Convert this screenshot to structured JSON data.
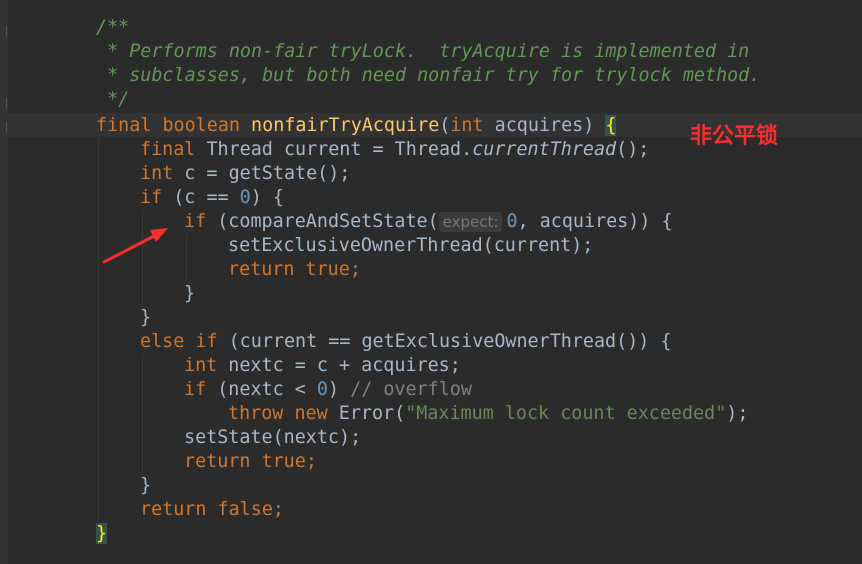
{
  "editor": {
    "annotation": "非公平锁",
    "colors": {
      "background": "#2b2b2b",
      "keyword": "#cc7832",
      "function": "#ffc66d",
      "doc_comment": "#629755",
      "number": "#6897bb",
      "string": "#6a8759",
      "annotation": "#ff2d2d"
    },
    "lines": {
      "l1": {
        "doc": "/**"
      },
      "l2": {
        "doc": " * Performs non-fair tryLock.  tryAcquire is implemented in"
      },
      "l3": {
        "doc": " * subclasses, but both need nonfair try for trylock method."
      },
      "l4": {
        "doc": " */"
      },
      "l5": {
        "kw1": "final",
        "kw2": "boolean",
        "fn": "nonfairTryAcquire",
        "p1": "(",
        "kw3": "int",
        "p2": " acquires) ",
        "brace": "{"
      },
      "l6": {
        "kw": "final",
        "t1": " Thread current = Thread.",
        "it": "currentThread",
        "t2": "();"
      },
      "l7": {
        "kw": "int",
        "t1": " c = getState();"
      },
      "l8": {
        "kw": "if",
        "t1": " (c == ",
        "num": "0",
        "t2": ") {"
      },
      "l9": {
        "kw": "if",
        "t1": " (compareAndSetState(",
        "hint": "expect:",
        "num": "0",
        "t2": ", acquires)) {"
      },
      "l10": {
        "t1": "setExclusiveOwnerThread(current);"
      },
      "l11": {
        "kw1": "return",
        "kw2": "true",
        "t1": ";"
      },
      "l12": {
        "t1": "}"
      },
      "l13": {
        "t1": "}"
      },
      "l14": {
        "kw1": "else",
        "kw2": "if",
        "t1": " (current == getExclusiveOwnerThread()) {"
      },
      "l15": {
        "kw": "int",
        "t1": " nextc = c + acquires;"
      },
      "l16": {
        "kw": "if",
        "t1": " (nextc < ",
        "num": "0",
        "t2": ") ",
        "cm": "// overflow"
      },
      "l17": {
        "kw1": "throw",
        "kw2": "new",
        "t1": " Error(",
        "str": "\"Maximum lock count exceeded\"",
        "t2": ");"
      },
      "l18": {
        "t1": "setState(nextc);"
      },
      "l19": {
        "kw1": "return",
        "kw2": "true",
        "t1": ";"
      },
      "l20": {
        "t1": "}"
      },
      "l21": {
        "kw1": "return",
        "kw2": "false",
        "t1": ";"
      },
      "l22": {
        "brace": "}"
      }
    }
  }
}
